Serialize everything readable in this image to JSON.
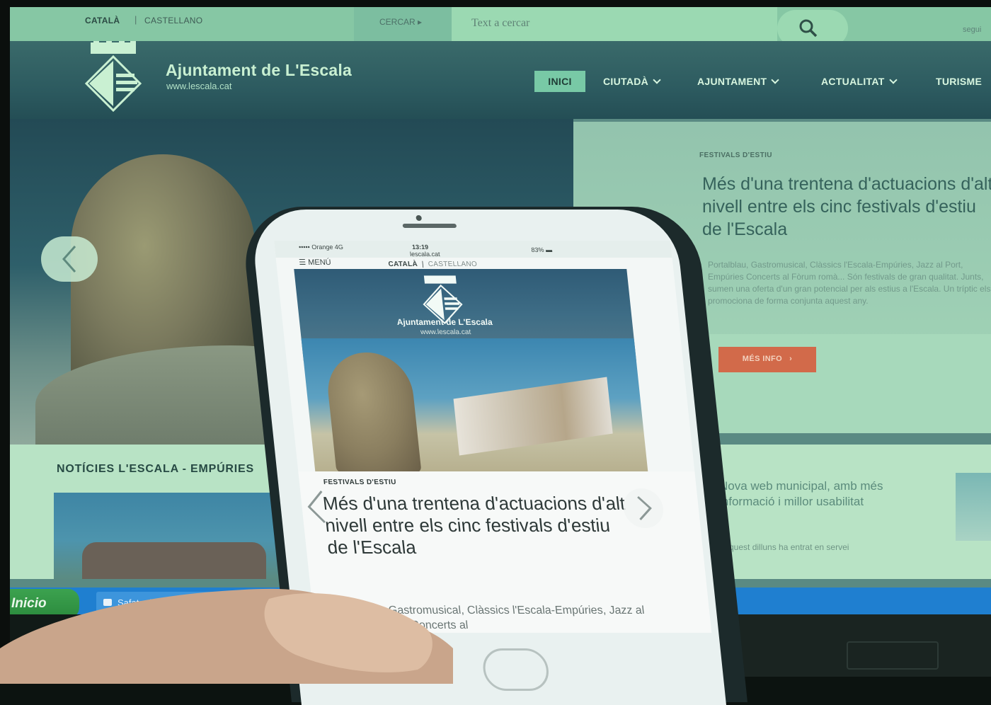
{
  "desktop": {
    "languages": {
      "active": "CATALÀ",
      "alternate": "CASTELLANO"
    },
    "search": {
      "select_label": "CERCAR",
      "placeholder": "Text a cercar"
    },
    "user_link": "segui",
    "site": {
      "title": "Ajuntament de L'Escala",
      "url": "www.lescala.cat"
    },
    "nav": [
      {
        "label": "INICI"
      },
      {
        "label": "CIUTADÀ"
      },
      {
        "label": "AJUNTAMENT"
      },
      {
        "label": "ACTUALITAT"
      },
      {
        "label": "TURISME"
      }
    ],
    "hero": {
      "tag": "FESTIVALS D'ESTIU",
      "title": "Més d'una trentena d'actuacions d'alt nivell entre els cinc festivals d'estiu de l'Escala",
      "body": "Portalblau, Gastromusical, Clàssics l'Escala-Empúries, Jazz al Port, Empúries Concerts al Fòrum romà... Són festivals de gran qualitat. Junts, sumen una oferta d'un gran potencial per als estius a l'Escala. Un tríptic els promociona de forma conjunta aquest any.",
      "button": "MÉS INFO"
    },
    "news": {
      "heading": "NOTÍCIES L'ESCALA - EMPÚRIES",
      "card_title": "Nova web municipal, amb més informació i millor usabilitat",
      "card_body": "Aquest dilluns ha entrat en servei"
    },
    "taskbar": {
      "start": "Inicio",
      "item": "Safata d'entrada - Pr..."
    }
  },
  "phone": {
    "status": {
      "carrier": "••••• Orange 4G",
      "time": "13:19",
      "url": "lescala.cat",
      "battery": "83%"
    },
    "menu": "MENÚ",
    "languages": {
      "active": "CATALÀ",
      "alternate": "CASTELLANO"
    },
    "site": {
      "title": "Ajuntament de L'Escala",
      "url": "www.lescala.cat"
    },
    "slide": {
      "tag": "FESTIVALS D'ESTIU",
      "title": "Més d'una trentena d'actuacions d'alt nivell entre els cinc festivals d'estiu de l'Escala",
      "body": "Portalblau, Gastromusical, Clàssics l'Escala-Empúries, Jazz al Port, Empúries Concerts al"
    }
  },
  "colors": {
    "accent_green": "#78c9a6",
    "button_orange": "#d26a4a",
    "taskbar_blue": "#1f7fd0",
    "start_green": "#2b8a3d"
  }
}
